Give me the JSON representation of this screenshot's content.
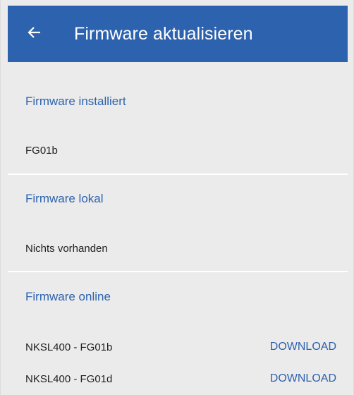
{
  "header": {
    "title": "Firmware aktualisieren",
    "back_icon": "arrow-left-icon"
  },
  "installed": {
    "title": "Firmware installiert",
    "value": "FG01b"
  },
  "local": {
    "title": "Firmware lokal",
    "value": "Nichts vorhanden"
  },
  "online": {
    "title": "Firmware online",
    "items": [
      {
        "name": "NKSL400 - FG01b",
        "action": "DOWNLOAD"
      },
      {
        "name": "NKSL400 - FG01d",
        "action": "DOWNLOAD"
      }
    ]
  },
  "colors": {
    "accent": "#2d62ae",
    "background": "#ebebeb",
    "divider": "#ffffff",
    "text": "#1f1f1f"
  }
}
